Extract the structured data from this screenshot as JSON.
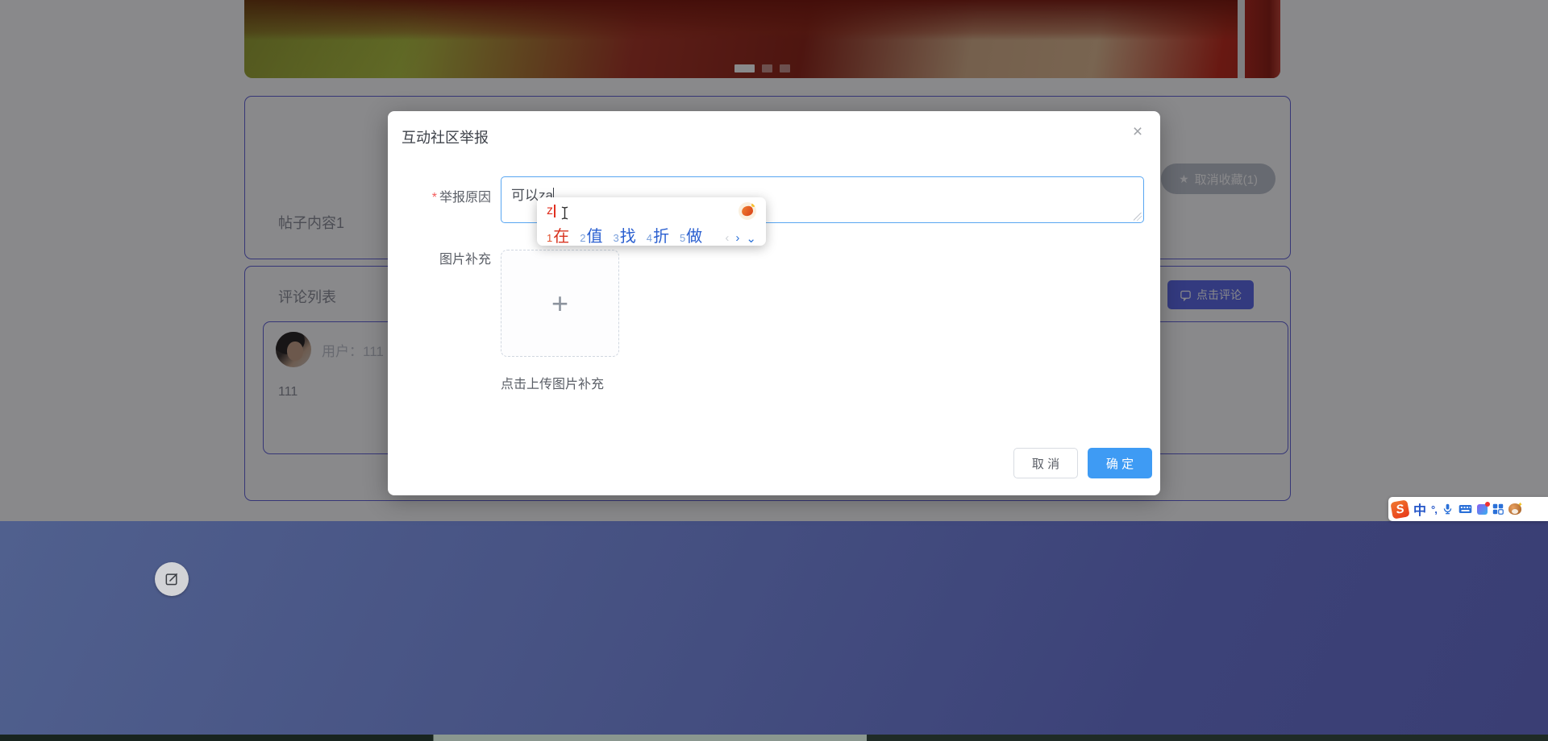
{
  "page": {
    "carousel": {
      "indicator_count": 3,
      "active_index": 0
    },
    "post_panel": {
      "title": "帖子内容1",
      "unfavorite_button_label": "取消收藏(1)",
      "unfavorite_icon": "star-icon"
    },
    "comment_panel": {
      "title": "评论列表",
      "comment_button_label": "点击评论",
      "comment_button_icon": "chat-icon",
      "comment": {
        "user_label": "用户：111",
        "content": "111"
      }
    },
    "footer": {
      "compose_icon": "edit-icon"
    }
  },
  "modal": {
    "title": "互动社区举报",
    "close_glyph": "×",
    "reason": {
      "required_mark": "*",
      "label": "举报原因",
      "value": "可以za"
    },
    "image_label": "图片补充",
    "upload_plus_glyph": "+",
    "upload_hint": "点击上传图片补充",
    "cancel_label": "取 消",
    "confirm_label": "确 定"
  },
  "ime": {
    "composition": "z",
    "candidates": [
      {
        "num": "1",
        "char": "在"
      },
      {
        "num": "2",
        "char": "值"
      },
      {
        "num": "3",
        "char": "找"
      },
      {
        "num": "4",
        "char": "折"
      },
      {
        "num": "5",
        "char": "做"
      }
    ],
    "pager": {
      "prev": "‹",
      "next": "›",
      "expand": "⌄"
    },
    "logo_icon": "sogou-logo-icon"
  },
  "sogou_toolbar": {
    "logo_glyph": "S",
    "mode_label": "中",
    "punct_label": "°,",
    "icons": [
      "mic-icon",
      "keyboard-icon",
      "skin-icon",
      "toolbox-icon",
      "assistant-icon"
    ]
  },
  "colors": {
    "accent_blue": "#3e9bf4",
    "panel_border": "#6060d8",
    "comment_button": "#5a68e8",
    "ime_candidate_blue": "#2a5fd0",
    "ime_candidate_red": "#d83420",
    "footer_top": "#50608e",
    "footer_bottom": "#3a3e74",
    "overlay": "rgba(8,8,12,0.48)"
  }
}
